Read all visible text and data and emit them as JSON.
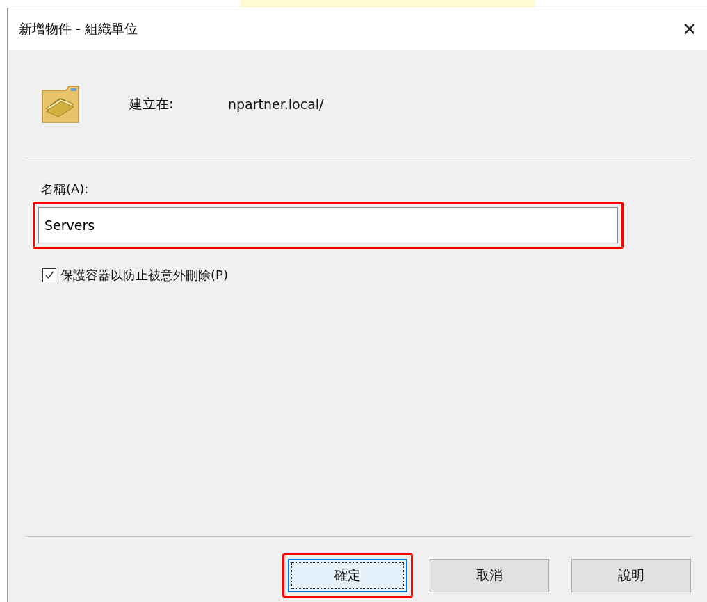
{
  "window": {
    "title": "新增物件 - 組織單位",
    "close": "✕"
  },
  "location": {
    "label": "建立在:",
    "value": "npartner.local/"
  },
  "name": {
    "label": "名稱(A):",
    "value": "Servers",
    "highlighted": true
  },
  "protect": {
    "label": "保護容器以防止被意外刪除(P)",
    "checked": true
  },
  "buttons": [
    {
      "label": "確定",
      "default": true,
      "highlighted": true
    },
    {
      "label": "取消",
      "default": false,
      "highlighted": false
    },
    {
      "label": "說明",
      "default": false,
      "highlighted": false
    }
  ]
}
